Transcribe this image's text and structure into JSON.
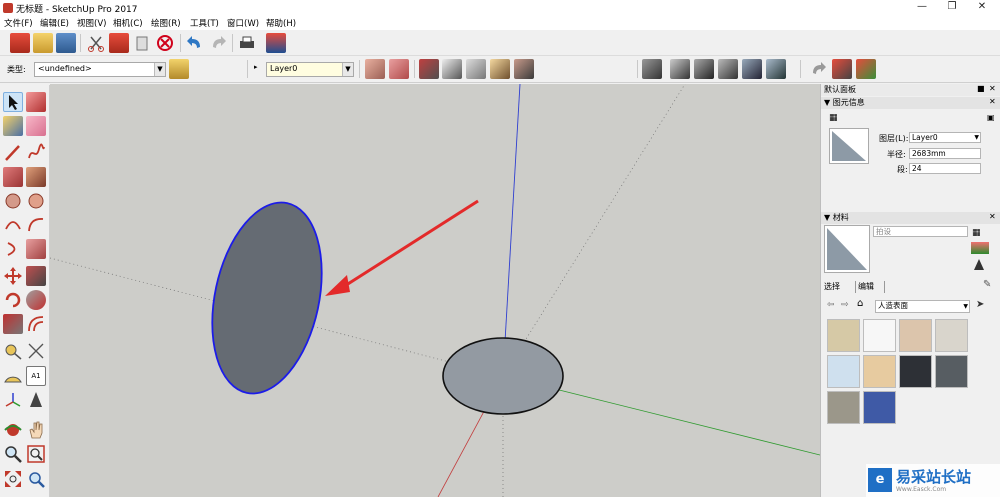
{
  "window": {
    "title": "无标题 - SketchUp Pro 2017"
  },
  "menu": [
    "文件(F)",
    "编辑(E)",
    "视图(V)",
    "相机(C)",
    "绘图(R)",
    "工具(T)",
    "窗口(W)",
    "帮助(H)"
  ],
  "toolbar2": {
    "type_label": "类型:",
    "type_value": "<undefined>",
    "layer_value": "Layer0"
  },
  "panel": {
    "title": "默认面板",
    "entity_info": {
      "header": "图元信息",
      "layer_label": "图层(L):",
      "layer_value": "Layer0",
      "radius_label": "半径:",
      "radius_value": "2683mm",
      "segments_label": "段:",
      "segments_value": "24"
    },
    "materials": {
      "header": "材料",
      "name_placeholder": "拍设",
      "tab_select": "选择",
      "tab_edit": "编辑",
      "library": "人造表面",
      "swatches": [
        "#d6c9a6",
        "#f7f7f7",
        "#dcc5ac",
        "#d9d5cc",
        "#cfe0ee",
        "#e7cba0",
        "#2d3036",
        "#575d62",
        "#9b978a",
        "#3f5aa6"
      ]
    }
  },
  "watermark": {
    "name": "易采站长站",
    "url": "Www.Easck.Com"
  }
}
